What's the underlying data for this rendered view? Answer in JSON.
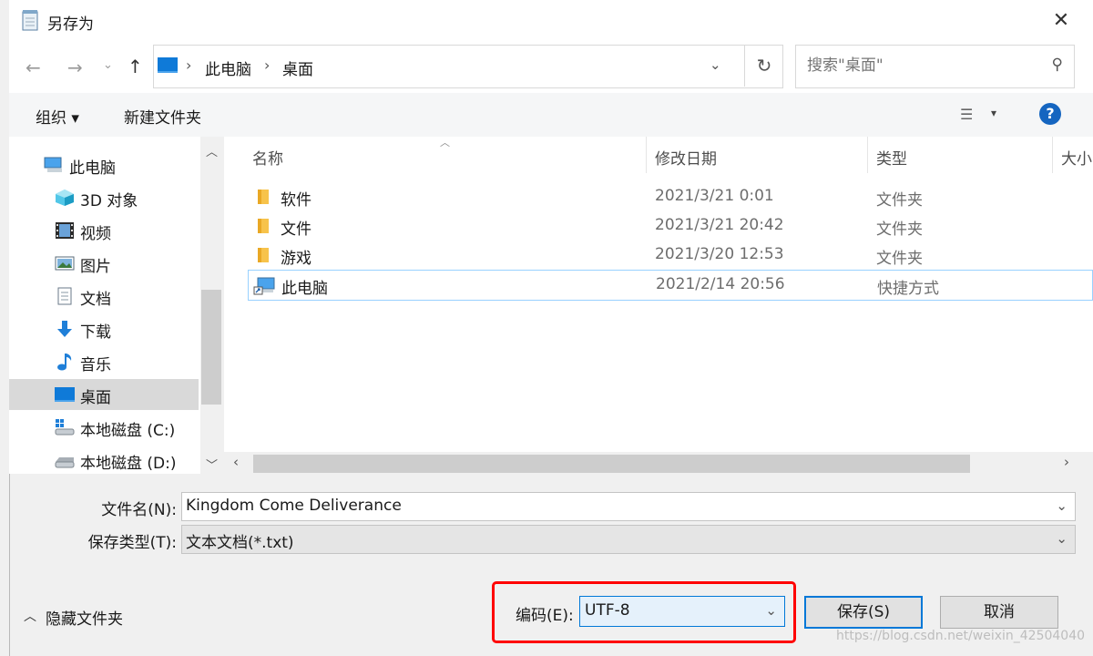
{
  "window": {
    "title": "另存为"
  },
  "address": {
    "crumbs": [
      "此电脑",
      "桌面"
    ]
  },
  "search": {
    "placeholder": "搜索\"桌面\""
  },
  "toolbar": {
    "organize": "组织 ▾",
    "new_folder": "新建文件夹"
  },
  "sidebar": {
    "items": [
      {
        "label": "此电脑",
        "icon": "computer-icon"
      },
      {
        "label": "3D 对象",
        "icon": "cube-icon"
      },
      {
        "label": "视频",
        "icon": "video-icon"
      },
      {
        "label": "图片",
        "icon": "picture-icon"
      },
      {
        "label": "文档",
        "icon": "document-icon"
      },
      {
        "label": "下载",
        "icon": "download-icon"
      },
      {
        "label": "音乐",
        "icon": "music-icon"
      },
      {
        "label": "桌面",
        "icon": "desktop-icon",
        "selected": true
      },
      {
        "label": "本地磁盘 (C:)",
        "icon": "windows-drive-icon"
      },
      {
        "label": "本地磁盘 (D:)",
        "icon": "drive-icon"
      }
    ]
  },
  "columns": {
    "name": "名称",
    "date": "修改日期",
    "type": "类型",
    "size": "大小"
  },
  "files": [
    {
      "name": "软件",
      "date": "2021/3/21 0:01",
      "type": "文件夹",
      "icon": "folder-icon"
    },
    {
      "name": "文件",
      "date": "2021/3/21 20:42",
      "type": "文件夹",
      "icon": "folder-icon"
    },
    {
      "name": "游戏",
      "date": "2021/3/20 12:53",
      "type": "文件夹",
      "icon": "folder-icon"
    },
    {
      "name": "此电脑",
      "date": "2021/2/14 20:56",
      "type": "快捷方式",
      "icon": "shortcut-icon",
      "selected": true
    }
  ],
  "form": {
    "filename_label": "文件名(N):",
    "filename_value": "Kingdom Come Deliverance",
    "filetype_label": "保存类型(T):",
    "filetype_value": "文本文档(*.txt)",
    "encoding_label": "编码(E):",
    "encoding_value": "UTF-8"
  },
  "footer": {
    "hide_folders": "隐藏文件夹",
    "save": "保存(S)",
    "cancel": "取消",
    "watermark": "https://blog.csdn.net/weixin_42504040"
  },
  "colors": {
    "accent": "#0078d7",
    "highlight_box": "#ff0000",
    "selection": "#d9d9d9"
  }
}
